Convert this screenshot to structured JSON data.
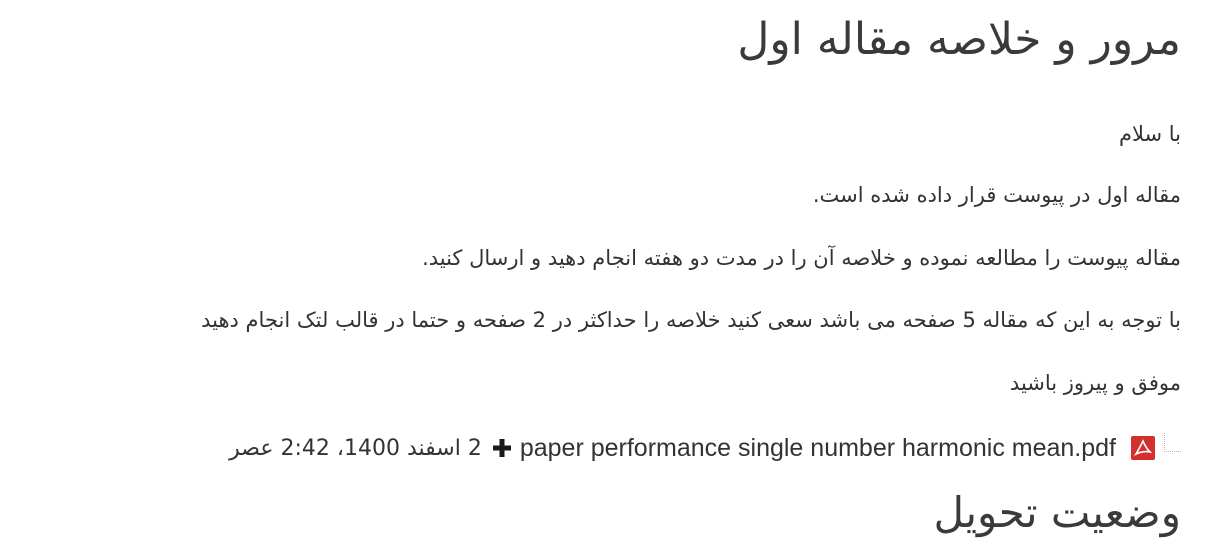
{
  "page": {
    "title": "مرور و خلاصه مقاله اول"
  },
  "description": {
    "paragraphs": [
      "با سلام",
      "مقاله اول در پیوست قرار داده شده است.",
      "مقاله پیوست را مطالعه نموده و خلاصه آن را در مدت دو هفته انجام دهید و ارسال کنید.",
      "با توجه به این که مقاله 5 صفحه می باشد سعی کنید خلاصه را حداکثر در 2 صفحه و حتما در قالب لتک انجام دهید",
      "موفق و پیروز باشید"
    ]
  },
  "attachment": {
    "icon": "pdf-file-icon",
    "file_name": "paper performance single number harmonic mean.pdf",
    "action_icon": "plus-icon",
    "date": "2 اسفند 1400، 2:42 عصر"
  },
  "submission": {
    "section_title": "وضعیت تحویل"
  },
  "colors": {
    "text": "#333333",
    "heading": "#3a3a3a",
    "pdf_red": "#d32f2f",
    "icon_dark": "#1a1a1a"
  }
}
